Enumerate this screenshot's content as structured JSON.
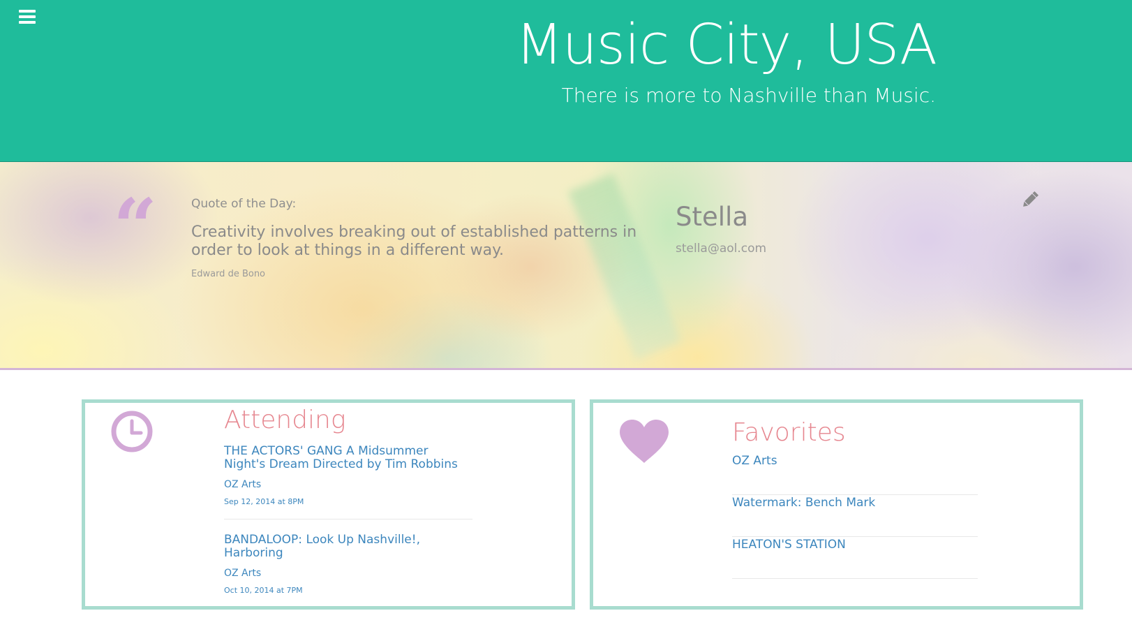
{
  "header": {
    "title": "Music City, USA",
    "subtitle": "There is more to Nashville than Music.",
    "background_color": "#1fbc9b"
  },
  "quote": {
    "label": "Quote of the Day:",
    "text": "Creativity involves breaking out of established patterns in order to look at things in a different way.",
    "author": "Edward de Bono"
  },
  "profile": {
    "name": "Stella",
    "email": "stella@aol.com"
  },
  "attending": {
    "title": "Attending",
    "events": [
      {
        "name": "THE ACTORS' GANG A Midsummer Night's Dream Directed by Tim Robbins",
        "venue": "OZ Arts",
        "date": "Sep 12, 2014 at 8PM"
      },
      {
        "name": "BANDALOOP: Look Up Nashville!, Harboring",
        "venue": "OZ Arts",
        "date": "Oct 10, 2014 at 7PM"
      }
    ]
  },
  "favorites": {
    "title": "Favorites",
    "items": [
      "OZ Arts",
      "Watermark: Bench Mark",
      "HEATON'S STATION"
    ]
  },
  "colors": {
    "accent_teal": "#1fbc9b",
    "card_border": "#a8dccf",
    "icon_purple": "#d2a8d6",
    "heading_pink": "#e6868f",
    "link_blue": "#3c86bd"
  },
  "icons": {
    "menu": "menu-icon",
    "quote": "quote-icon",
    "edit": "pencil-icon",
    "clock": "clock-icon",
    "heart": "heart-icon"
  }
}
